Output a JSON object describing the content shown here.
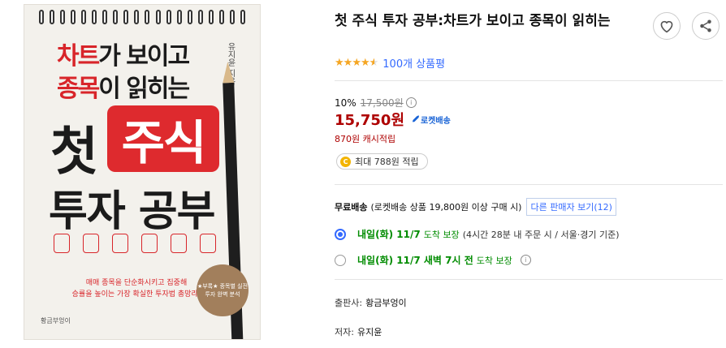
{
  "cover": {
    "line1_red": "차트",
    "line1_rest": "가 보이고",
    "line2_red": "종목",
    "line2_rest": "이 읽히는",
    "big_black": "첫",
    "big_red": "주식",
    "big_line2": "투자 공부",
    "author_vertical": "유지윤 지음",
    "desc_line1": "매매 종목을 단순화시키고 집중해",
    "desc_line2": "승률을 높이는 가장 확실한 투자법 총망라!",
    "badge_text": "★부록★ 종목별 실전 투자 완벽 분석",
    "publisher_logo": "황금부엉이"
  },
  "product": {
    "title": "첫 주식 투자 공부:차트가 보이고 종목이 읽히는",
    "rating_count": "100개 상품평",
    "discount_rate": "10%",
    "original_price": "17,500원",
    "price": "15,750원",
    "rocket_label": "로켓배송",
    "cash_reward": "870원 캐시적립",
    "max_reward": "최대 788원 적립",
    "coin_letter": "C"
  },
  "shipping": {
    "free_label": "무료배송",
    "free_condition": "(로켓배송 상품 19,800원 이상 구매 시)",
    "other_sellers": "다른 판매자 보기(12)",
    "option1_date": "내일(화) 11/7",
    "option1_guarantee": "도착 보장",
    "option1_note": "(4시간 28분 내 주문 시 / 서울·경기 기준)",
    "option2_date": "내일(화) 11/7 새벽 7시 전",
    "option2_guarantee": "도착 보장"
  },
  "meta": {
    "publisher_key": "출판사:",
    "publisher_val": "황금부엉이",
    "author_key": "저자:",
    "author_val": "유지윤"
  },
  "icons": {
    "heart": "heart-icon",
    "share": "share-icon",
    "info": "info-icon",
    "rocket": "rocket-icon",
    "colors": {
      "star": "#f5a623",
      "price": "#ae0000",
      "link": "#346aff",
      "green": "#008c00"
    }
  }
}
